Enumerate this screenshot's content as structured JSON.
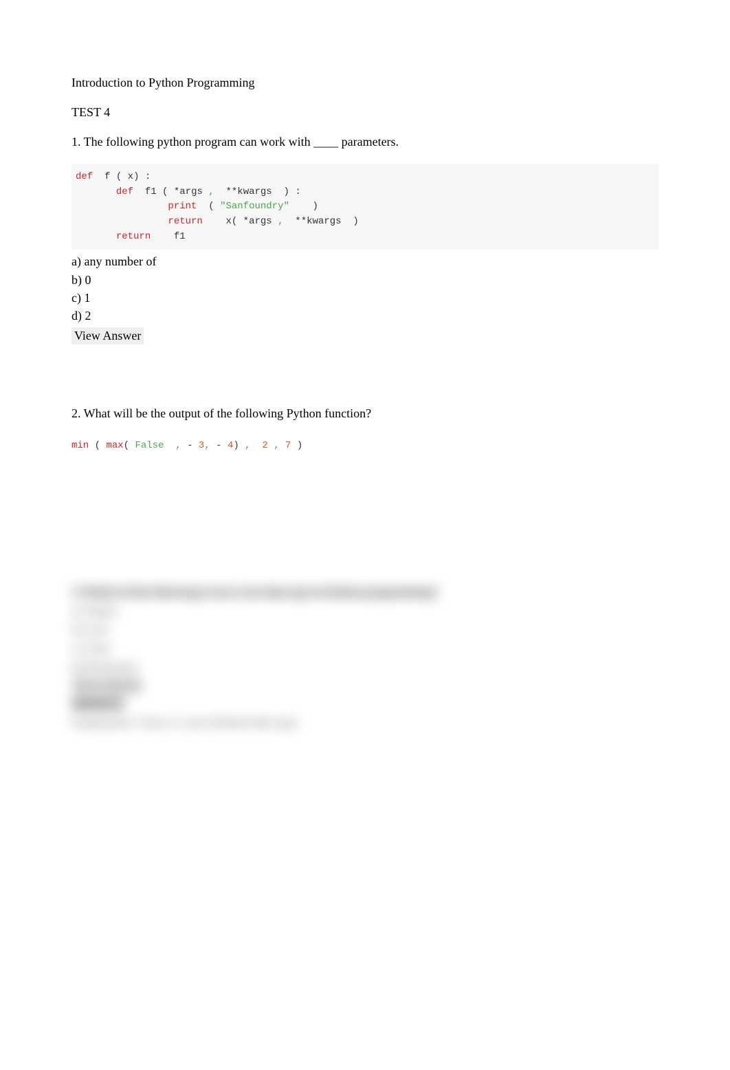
{
  "heading": "Introduction to Python Programming",
  "test_label": "TEST 4",
  "q1": {
    "prompt": "1. The following python program can work with ____ parameters.",
    "code": {
      "l1_def": "def",
      "l1_rest": "  f",
      "l1_p1": "(",
      "l1_x": "x",
      "l1_p2": ")",
      "l1_colon": ":",
      "l2_def": "def",
      "l2_name": "  f1",
      "l2_p1": "(",
      "l2_args": "*args",
      "l2_c1": ",",
      "l2_kw": "  **kwargs",
      "l2_p2": ")",
      "l2_colon": ":",
      "l3_print": "print",
      "l3_p1": "  (",
      "l3_str": "\"Sanfoundry\"",
      "l3_p2": "    )",
      "l4_ret": "return",
      "l4_call": "    x",
      "l4_p1": "(",
      "l4_args": "*args",
      "l4_c1": ",",
      "l4_kw": "  **kwargs",
      "l4_p2": ")",
      "l5_ret": "return",
      "l5_f1": "    f1"
    },
    "opt_a": "a) any number of",
    "opt_b": "b) 0",
    "opt_c": "c) 1",
    "opt_d": "d) 2",
    "view_answer": "View Answer"
  },
  "q2": {
    "prompt": "2. What will be the output of the following Python function?",
    "code": {
      "min": "min",
      "p1": "(",
      "max": "max",
      "p2": "(",
      "false": "False",
      "c1": "  ,",
      "m1": "-",
      "n3": "3",
      "c2": ",",
      "m2": "-",
      "n4": "4",
      "p3": ")",
      "c3": ",",
      "n2": "  2",
      "c4": ",",
      "n7": "7",
      "p4": ")"
    }
  },
  "blurred": {
    "q_line": "3. Which of the following is not a core data type in Python programming?",
    "opt_a": "a) Tuples",
    "opt_b": "b) Lists",
    "opt_c": "c) Class",
    "opt_d": "d) Dictionary",
    "view_answer": "View Answer",
    "ans": "Answer: c",
    "exp": "Explanation: Class is a user-defined data type."
  }
}
